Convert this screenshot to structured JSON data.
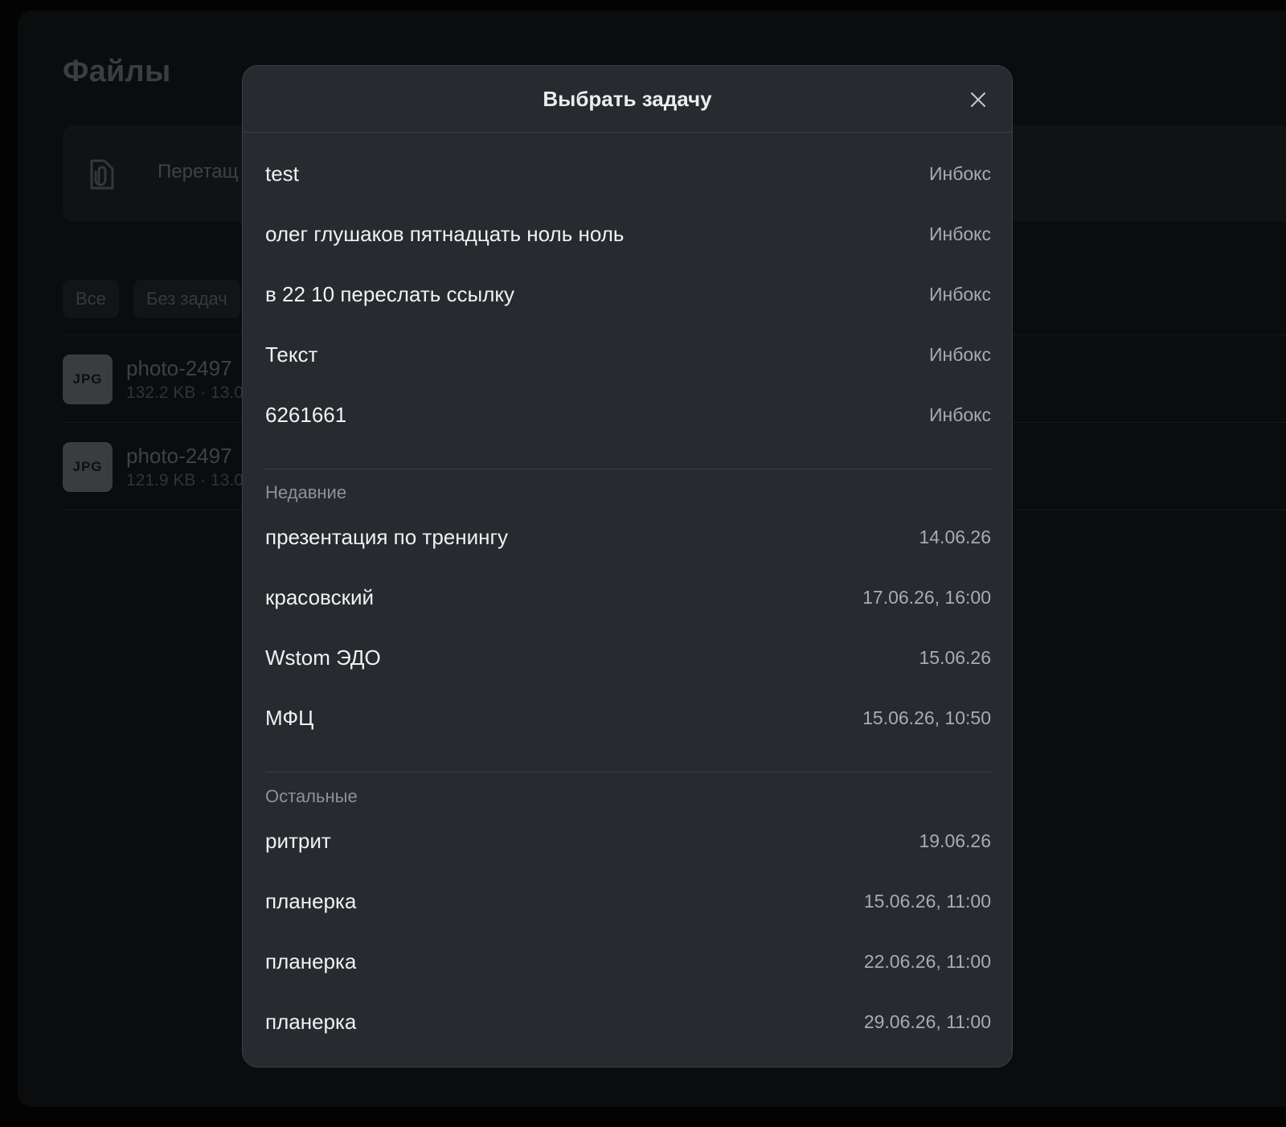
{
  "background": {
    "page_title": "Файлы",
    "dropzone_text": "Перетащ",
    "filters": [
      "Все",
      "Без задач"
    ],
    "files": [
      {
        "badge": "JPG",
        "name": "photo-2497",
        "meta": "132.2 KB · 13.0"
      },
      {
        "badge": "JPG",
        "name": "photo-2497",
        "meta": "121.9 KB · 13.0"
      }
    ]
  },
  "modal": {
    "title": "Выбрать задачу",
    "inbox": [
      {
        "title": "test",
        "meta": "Инбокс"
      },
      {
        "title": "олег глушаков пятнадцать ноль ноль",
        "meta": "Инбокс"
      },
      {
        "title": "в 22 10 переслать ссылку",
        "meta": "Инбокс"
      },
      {
        "title": "Текст",
        "meta": "Инбокс"
      },
      {
        "title": "6261661",
        "meta": "Инбокс"
      }
    ],
    "recent_label": "Недавние",
    "recent": [
      {
        "title": "презентация по тренингу",
        "meta": "14.06.26"
      },
      {
        "title": "красовский",
        "meta": "17.06.26, 16:00"
      },
      {
        "title": "Wstom ЭДО",
        "meta": "15.06.26"
      },
      {
        "title": "МФЦ",
        "meta": "15.06.26, 10:50"
      }
    ],
    "others_label": "Остальные",
    "others": [
      {
        "title": "ритрит",
        "meta": "19.06.26"
      },
      {
        "title": "планерка",
        "meta": "15.06.26, 11:00"
      },
      {
        "title": "планерка",
        "meta": "22.06.26, 11:00"
      },
      {
        "title": "планерка",
        "meta": "29.06.26, 11:00"
      }
    ]
  },
  "colors": {
    "modal_bg": "#272a2e",
    "page_bg": "#030303",
    "text_primary": "#f1f1f2",
    "text_secondary": "#a8abaf"
  },
  "icons": {
    "close": "close-icon",
    "dropzone": "paperclip-file-icon"
  }
}
